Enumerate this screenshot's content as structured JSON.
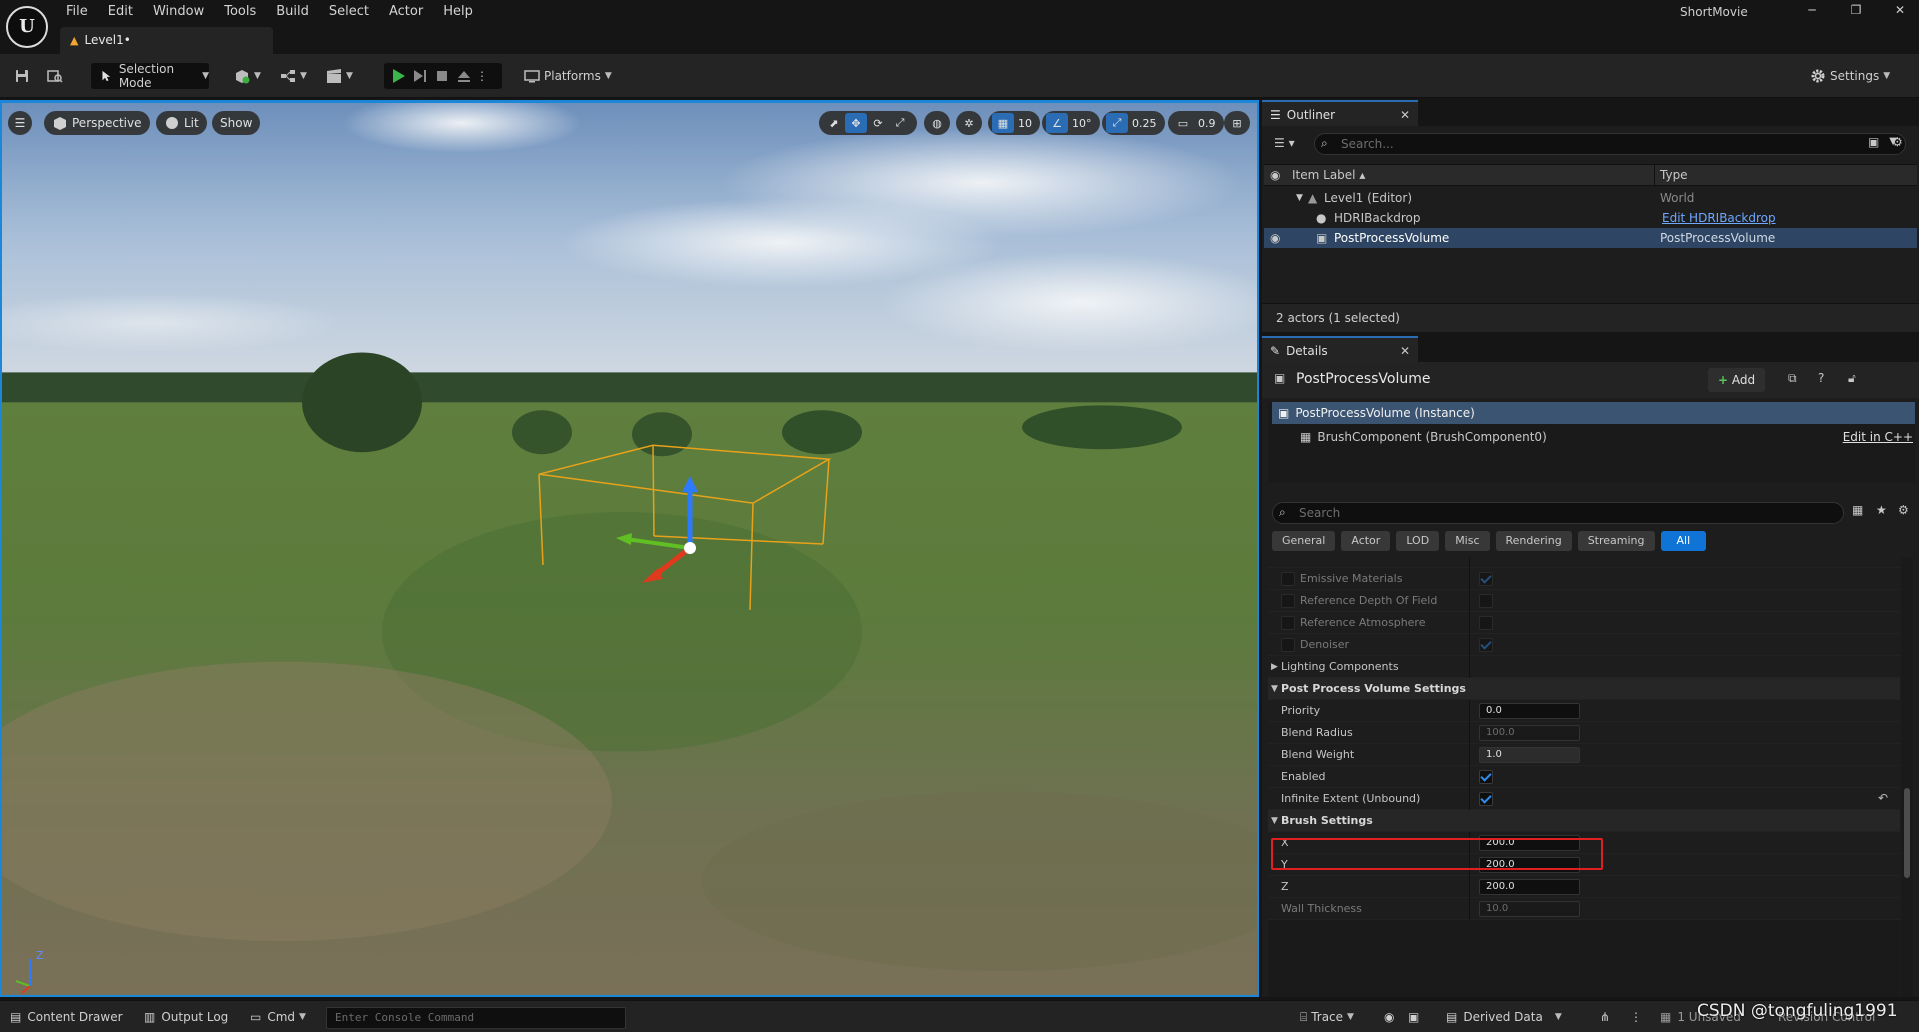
{
  "window": {
    "app_title": "ShortMovie",
    "level_tab": "Level1•",
    "menu": [
      "File",
      "Edit",
      "Window",
      "Tools",
      "Build",
      "Select",
      "Actor",
      "Help"
    ]
  },
  "toolbar": {
    "selection_mode": "Selection Mode",
    "platforms": "Platforms",
    "settings": "Settings"
  },
  "viewport": {
    "perspective": "Perspective",
    "lit": "Lit",
    "show": "Show",
    "grid_snap": "10",
    "rotation_snap": "10°",
    "scale_snap": "0.25",
    "camera_speed": "0.9",
    "axis_z": "Z"
  },
  "outliner": {
    "tab": "Outliner",
    "search_placeholder": "Search...",
    "col_label": "Item Label",
    "col_type": "Type",
    "rows": [
      {
        "label": "Level1 (Editor)",
        "type": "World"
      },
      {
        "label": "HDRIBackdrop",
        "type": "Edit HDRIBackdrop"
      },
      {
        "label": "PostProcessVolume",
        "type": "PostProcessVolume"
      }
    ],
    "footer": "2 actors (1 selected)"
  },
  "details": {
    "tab": "Details",
    "actor_name": "PostProcessVolume",
    "add_label": "Add",
    "components": [
      {
        "label": "PostProcessVolume (Instance)"
      },
      {
        "label": "BrushComponent (BrushComponent0)",
        "action": "Edit in C++"
      }
    ],
    "search_placeholder": "Search",
    "filters": [
      "General",
      "Actor",
      "LOD",
      "Misc",
      "Rendering",
      "Streaming",
      "All"
    ],
    "props": {
      "emissive": "Emissive Materials",
      "ref_dof": "Reference Depth Of Field",
      "ref_atmo": "Reference Atmosphere",
      "denoiser": "Denoiser",
      "lighting": "Lighting Components",
      "ppv_settings": "Post Process Volume Settings",
      "priority": "Priority",
      "priority_val": "0.0",
      "blend_radius": "Blend Radius",
      "blend_radius_val": "100.0",
      "blend_weight": "Blend Weight",
      "blend_weight_val": "1.0",
      "enabled": "Enabled",
      "infinite": "Infinite Extent (Unbound)",
      "brush_settings": "Brush Settings",
      "x": "X",
      "x_val": "200.0",
      "y": "Y",
      "y_val": "200.0",
      "z": "Z",
      "z_val": "200.0",
      "wall": "Wall Thickness",
      "wall_val": "10.0"
    }
  },
  "statusbar": {
    "content_drawer": "Content Drawer",
    "output_log": "Output Log",
    "cmd": "Cmd",
    "console_placeholder": "Enter Console Command",
    "trace": "Trace",
    "derived_data": "Derived Data",
    "unsaved": "1 Unsaved",
    "revision": "Revision Control"
  },
  "watermark": "CSDN @tongfuling1991"
}
